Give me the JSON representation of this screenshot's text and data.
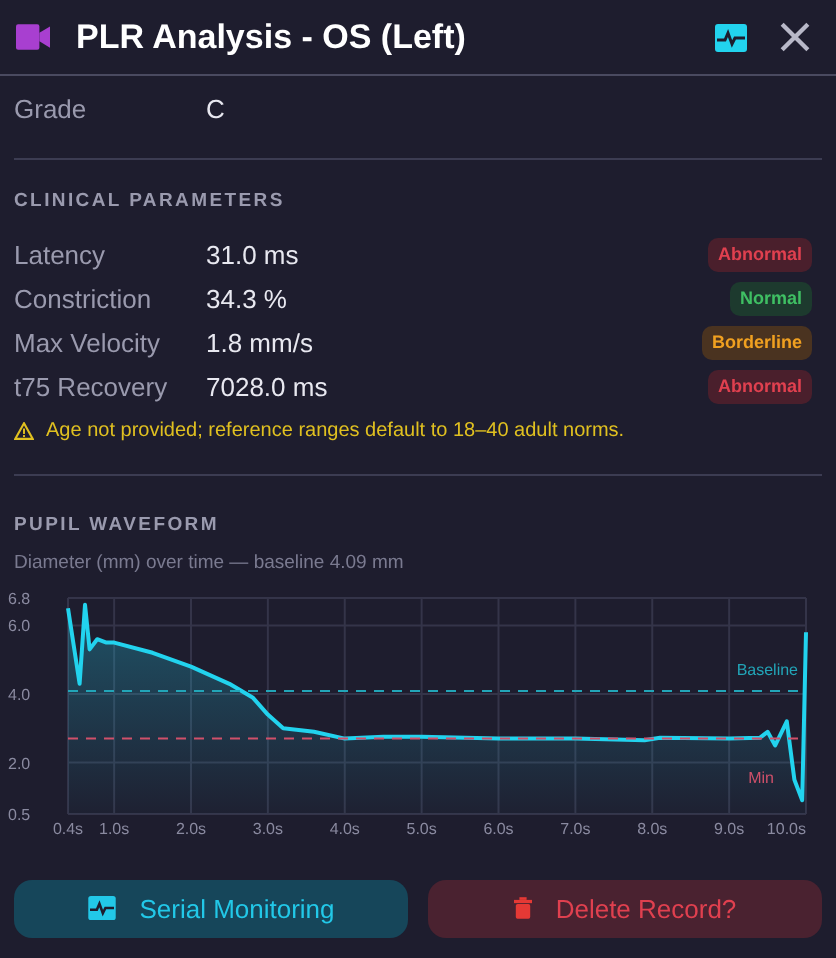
{
  "header": {
    "title": "PLR Analysis - OS (Left)"
  },
  "grade": {
    "label": "Grade",
    "value": "C"
  },
  "clinical": {
    "heading": "CLINICAL PARAMETERS",
    "rows": [
      {
        "label": "Latency",
        "value": "31.0 ms",
        "badge": "Abnormal",
        "kind": "abnormal"
      },
      {
        "label": "Constriction",
        "value": "34.3 %",
        "badge": "Normal",
        "kind": "normal"
      },
      {
        "label": "Max Velocity",
        "value": "1.8 mm/s",
        "badge": "Borderline",
        "kind": "borderline"
      },
      {
        "label": "t75 Recovery",
        "value": "7028.0 ms",
        "badge": "Abnormal",
        "kind": "abnormal"
      }
    ],
    "warning": "Age not provided; reference ranges default to 18–40 adult norms."
  },
  "waveform": {
    "heading": "PUPIL WAVEFORM",
    "subtitle": "Diameter (mm) over time — baseline 4.09 mm",
    "chart_data": {
      "type": "area",
      "grid": true,
      "xlim": [
        0.4,
        10.0
      ],
      "ylim": [
        0.5,
        6.8
      ],
      "xticks": [
        {
          "value": 0.4,
          "label": "0.4s"
        },
        {
          "value": 1.0,
          "label": "1.0s"
        },
        {
          "value": 2.0,
          "label": "2.0s"
        },
        {
          "value": 3.0,
          "label": "3.0s"
        },
        {
          "value": 4.0,
          "label": "4.0s"
        },
        {
          "value": 5.0,
          "label": "5.0s"
        },
        {
          "value": 6.0,
          "label": "6.0s"
        },
        {
          "value": 7.0,
          "label": "7.0s"
        },
        {
          "value": 8.0,
          "label": "8.0s"
        },
        {
          "value": 9.0,
          "label": "9.0s"
        },
        {
          "value": 10.0,
          "label": "10.0s"
        }
      ],
      "yticks": [
        {
          "value": 0.5,
          "label": "0.5"
        },
        {
          "value": 2.0,
          "label": "2.0"
        },
        {
          "value": 4.0,
          "label": "4.0"
        },
        {
          "value": 6.0,
          "label": "6.0"
        },
        {
          "value": 6.8,
          "label": "6.8"
        }
      ],
      "x": [
        0.4,
        0.55,
        0.62,
        0.68,
        0.78,
        0.9,
        1.0,
        1.5,
        2.0,
        2.5,
        2.8,
        3.0,
        3.2,
        3.6,
        4.0,
        4.5,
        5.0,
        6.0,
        7.0,
        7.9,
        8.1,
        9.0,
        9.4,
        9.5,
        9.6,
        9.75,
        9.85,
        9.95,
        10.0
      ],
      "series": [
        {
          "type": "area",
          "color": "#22d3ee",
          "values": [
            6.5,
            4.3,
            6.6,
            5.3,
            5.6,
            5.5,
            5.5,
            5.2,
            4.8,
            4.3,
            3.9,
            3.4,
            3.0,
            2.9,
            2.7,
            2.75,
            2.75,
            2.7,
            2.7,
            2.65,
            2.72,
            2.7,
            2.72,
            2.9,
            2.5,
            3.2,
            1.5,
            0.9,
            5.8
          ]
        },
        {
          "type": "line",
          "line_style": "dashed",
          "name": "Baseline",
          "color": "#22a5b8",
          "values": [
            4.09,
            4.09,
            4.09,
            4.09,
            4.09,
            4.09,
            4.09,
            4.09,
            4.09,
            4.09,
            4.09,
            4.09,
            4.09,
            4.09,
            4.09,
            4.09,
            4.09,
            4.09,
            4.09,
            4.09,
            4.09,
            4.09,
            4.09,
            4.09,
            4.09,
            4.09,
            4.09,
            4.09,
            4.09
          ]
        },
        {
          "type": "line",
          "line_style": "dashed",
          "name": "Min",
          "color": "#d0506a",
          "values": [
            2.7,
            2.7,
            2.7,
            2.7,
            2.7,
            2.7,
            2.7,
            2.7,
            2.7,
            2.7,
            2.7,
            2.7,
            2.7,
            2.7,
            2.7,
            2.7,
            2.7,
            2.7,
            2.7,
            2.7,
            2.7,
            2.7,
            2.7,
            2.7,
            2.7,
            2.7,
            2.7,
            2.7,
            2.7
          ]
        }
      ]
    }
  },
  "buttons": [
    {
      "label": "Serial Monitoring",
      "kind": "monitor"
    },
    {
      "label": "Delete Record?",
      "kind": "delete"
    }
  ]
}
